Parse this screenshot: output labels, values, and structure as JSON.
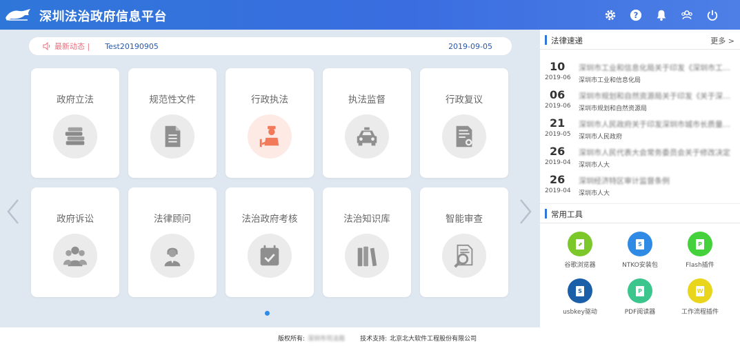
{
  "app": {
    "title": "深圳法治政府信息平台"
  },
  "header": {
    "icons": [
      "gear-icon",
      "help-icon",
      "bell-icon",
      "users-icon",
      "power-icon"
    ]
  },
  "news": {
    "label": "最新动态 |",
    "title": "Test20190905",
    "date": "2019-09-05"
  },
  "tiles": [
    {
      "label": "政府立法",
      "icon": "books-icon"
    },
    {
      "label": "规范性文件",
      "icon": "document-icon"
    },
    {
      "label": "行政执法",
      "icon": "officer-icon",
      "active": true
    },
    {
      "label": "执法监督",
      "icon": "police-car-icon"
    },
    {
      "label": "行政复议",
      "icon": "review-document-icon"
    },
    {
      "label": "政府诉讼",
      "icon": "people-icon"
    },
    {
      "label": "法律顾问",
      "icon": "advisor-icon"
    },
    {
      "label": "法治政府考核",
      "icon": "calendar-check-icon"
    },
    {
      "label": "法治知识库",
      "icon": "binders-icon"
    },
    {
      "label": "智能审查",
      "icon": "magnifier-document-icon"
    }
  ],
  "side": {
    "law_section": {
      "title": "法律速递",
      "more": "更多 >"
    },
    "law_items": [
      {
        "day": "10",
        "ym": "2019-06",
        "title": "深圳市工业和信息化局关于印发《深圳市工业和信息化局",
        "org": "深圳市工业和信息化局"
      },
      {
        "day": "06",
        "ym": "2019-06",
        "title": "深圳市规划和自然资源局关于印发《关于深入推进",
        "org": "深圳市规划和自然资源局"
      },
      {
        "day": "21",
        "ym": "2019-05",
        "title": "深圳市人民政府关于印发深圳市城市长质量管理",
        "org": "深圳市人民政府"
      },
      {
        "day": "26",
        "ym": "2019-04",
        "title": "深圳市人民代表大会常务委员会关于修改决定",
        "org": "深圳市人大"
      },
      {
        "day": "26",
        "ym": "2019-04",
        "title": "深圳经济特区审计监督条例",
        "org": "深圳市人大"
      }
    ],
    "tools_section": {
      "title": "常用工具"
    },
    "tools": [
      {
        "label": "谷歌浏览器",
        "color": "#7cc72a",
        "glyph": "",
        "icon": "chrome-icon"
      },
      {
        "label": "NTKO安装包",
        "color": "#2f8ae5",
        "glyph": "S",
        "icon": "ntko-icon"
      },
      {
        "label": "Flash插件",
        "color": "#45d13b",
        "glyph": "P",
        "icon": "flash-icon"
      },
      {
        "label": "usbkey驱动",
        "color": "#1b5fa8",
        "glyph": "S",
        "icon": "usbkey-icon"
      },
      {
        "label": "PDF阅读器",
        "color": "#3cc58d",
        "glyph": "P",
        "icon": "pdf-icon"
      },
      {
        "label": "工作流程插件",
        "color": "#e9d51c",
        "glyph": "W",
        "icon": "workflow-icon"
      }
    ]
  },
  "footer": {
    "copyright_label": "版权所有:",
    "copyright_value": "深圳市司法局",
    "support_label": "技术支持:",
    "support_value": "北京北大软件工程股份有限公司"
  },
  "colors": {
    "header": "#2f76d9",
    "accent": "#2f8ae5",
    "news_label": "#e8707d",
    "active_circle": "#fdeae5",
    "active_icon": "#f07a5a"
  }
}
